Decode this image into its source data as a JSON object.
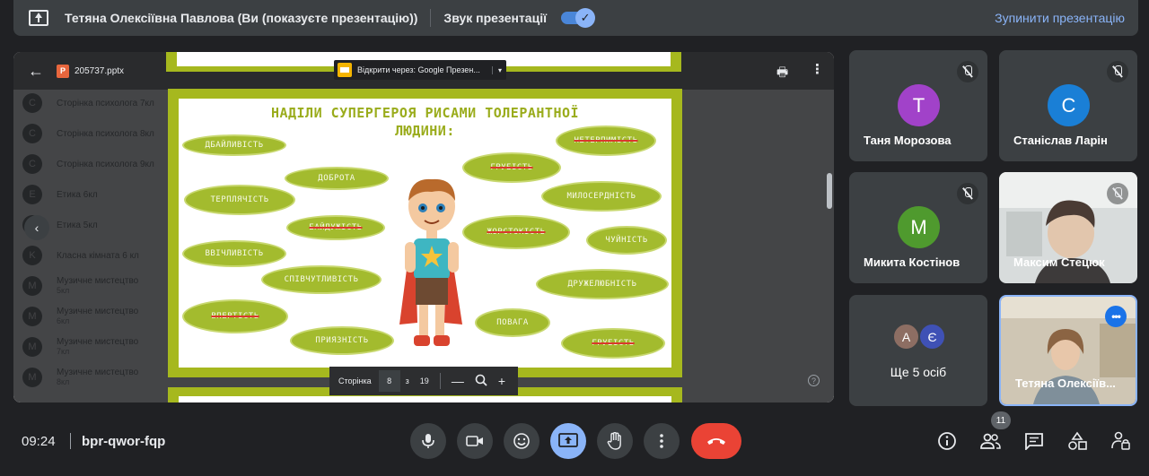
{
  "banner": {
    "title": "Тетяна Олексіївна Павлова (Ви (показуєте презентацію))",
    "sound_label": "Звук презентації",
    "toggle_check": "✓",
    "stop_label": "Зупинити презентацію"
  },
  "viewer": {
    "back_glyph": "←",
    "file_badge": "P",
    "file_name": "205737.pptx",
    "open_with_label": "Відкрити через: Google Презен...",
    "caret_glyph": "▾",
    "print_glyph": "🖶",
    "more_glyph": "⋮",
    "prev_glyph": "‹"
  },
  "classroom": {
    "items": [
      {
        "initial": "C",
        "label": "Сторінка психолога 7кл",
        "sub": ""
      },
      {
        "initial": "C",
        "label": "Сторінка психолога 8кл",
        "sub": ""
      },
      {
        "initial": "C",
        "label": "Сторінка психолога 9кл",
        "sub": ""
      },
      {
        "initial": "E",
        "label": "Етика 6кл",
        "sub": ""
      },
      {
        "initial": "E",
        "label": "Етика 5кл",
        "sub": ""
      },
      {
        "initial": "K",
        "label": "Класна кімната 6 кл",
        "sub": ""
      },
      {
        "initial": "M",
        "label": "Музичне мистецтво",
        "sub": "5кл"
      },
      {
        "initial": "M",
        "label": "Музичне мистецтво",
        "sub": "6кл"
      },
      {
        "initial": "M",
        "label": "Музичне мистецтво",
        "sub": "7кл"
      },
      {
        "initial": "M",
        "label": "Музичне мистецтво",
        "sub": "8кл"
      }
    ],
    "help_glyph": "?"
  },
  "slide": {
    "title_line1": "НАДІЛИ СУПЕРГЕРОЯ РИСАМИ ТОЛЕРАНТНОЇ",
    "title_line2": "ЛЮДИНИ:",
    "traits": [
      {
        "text": "ДБАЙЛИВІСТЬ",
        "struck": false
      },
      {
        "text": "НЕТЕРПИМІСТЬ",
        "struck": true
      },
      {
        "text": "ГРУБІСТЬ",
        "struck": true
      },
      {
        "text": "ДОБРОТА",
        "struck": false
      },
      {
        "text": "ТЕРПЛЯЧІСТЬ",
        "struck": false
      },
      {
        "text": "МИЛОСЕРДНІСТЬ",
        "struck": false
      },
      {
        "text": "БАЙДУЖІСТЬ",
        "struck": true
      },
      {
        "text": "ЖОРСТОКІСТЬ",
        "struck": true
      },
      {
        "text": "ЧУЙНІСТЬ",
        "struck": false
      },
      {
        "text": "ВВІЧЛИВІСТЬ",
        "struck": false
      },
      {
        "text": "СПІВЧУТЛИВІСТЬ",
        "struck": false
      },
      {
        "text": "ДРУЖЕЛЮБНІСТЬ",
        "struck": false
      },
      {
        "text": "ВПЕРТІСТЬ",
        "struck": true
      },
      {
        "text": "ПОВАГА",
        "struck": false
      },
      {
        "text": "ПРИЯЗНІСТЬ",
        "struck": false
      },
      {
        "text": "ГРУБІСТЬ",
        "struck": true
      }
    ]
  },
  "pager": {
    "label": "Сторінка",
    "current": "8",
    "of": "з",
    "total": "19",
    "zoom_out": "—",
    "zoom_in": "+"
  },
  "participants": [
    {
      "name": "Таня Морозова",
      "initial": "T",
      "color": "#a142c9",
      "muted": true
    },
    {
      "name": "Станіслав Ларін",
      "initial": "С",
      "color": "#1a7fd6",
      "muted": true
    },
    {
      "name": "Микита Костінов",
      "initial": "M",
      "color": "#4f9a2e",
      "muted": true
    },
    {
      "name": "Максим Стецюк",
      "muted": true,
      "video": true
    },
    {
      "name": "Тетяна Олексіїв...",
      "video": true,
      "self": true
    }
  ],
  "more_tile": {
    "label": "Ще 5 осіб",
    "avatars": [
      {
        "initial": "A",
        "color": "#8d6e63"
      },
      {
        "initial": "Є",
        "color": "#3f51b5"
      }
    ]
  },
  "self_options_glyph": "•••",
  "bottom": {
    "time": "09:24",
    "meeting_code": "bpr-qwor-fqp",
    "participants_count": "11"
  },
  "colors": {
    "slide_border": "#a6b81e",
    "oval_fill": "#a3bb2e",
    "accent": "#8ab4f8",
    "hangup": "#ea4335"
  }
}
